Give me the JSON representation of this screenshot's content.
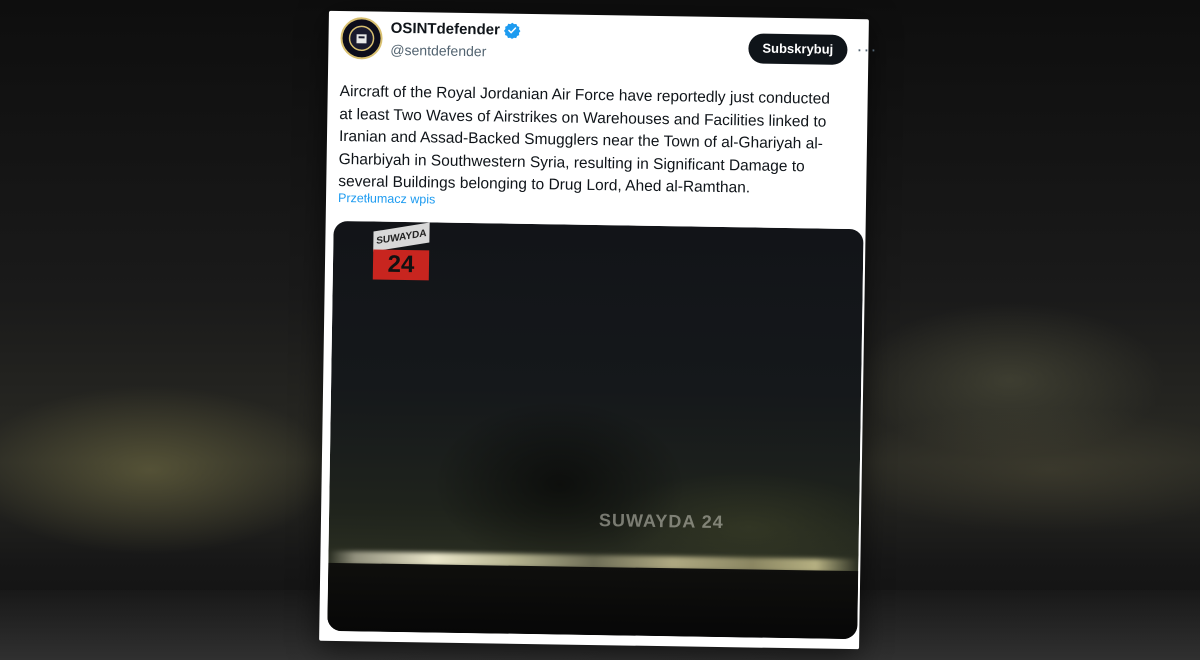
{
  "post": {
    "display_name": "OSINTdefender",
    "handle": "@sentdefender",
    "subscribe_label": "Subskrybuj",
    "more_label": "···",
    "text": "Aircraft of the Royal Jordanian Air Force have reportedly just conducted\nat least Two Waves of Airstrikes on Warehouses and Facilities linked to\nIranian and Assad-Backed Smugglers near the Town of al-Ghariyah al-\nGharbiyah in Southwestern Syria, resulting in Significant Damage to\nseveral Buildings belonging to Drug Lord, Ahed al-Ramthan.",
    "translate_label": "Przetłumacz wpis"
  },
  "media": {
    "logo_top": "SUWAYDA",
    "logo_number": "24",
    "watermark": "SUWAYDA 24"
  },
  "icons": {
    "verified": "verified-badge-icon",
    "more": "more-options-icon"
  },
  "colors": {
    "accent": "#1d9bf0",
    "button": "#0f1419",
    "logo_red": "#c8251f"
  }
}
